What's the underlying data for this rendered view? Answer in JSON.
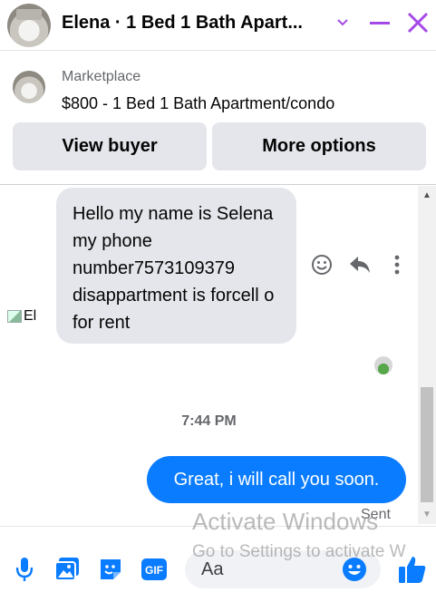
{
  "header": {
    "title": "Elena · 1 Bed 1 Bath Apart...",
    "accent_color": "#a548e8"
  },
  "listing": {
    "label": "Marketplace",
    "title": "$800 - 1 Bed 1 Bath Apartment/condo",
    "buttons": {
      "view_buyer": "View buyer",
      "more_options": "More options"
    }
  },
  "messages": {
    "incoming": {
      "text": "Hello my name is Selena my phone number7573109379 disappartment is forcell o for rent",
      "sender_alt": "El"
    },
    "timestamp": "7:44 PM",
    "outgoing": {
      "text": "Great, i will call you soon.",
      "status": "Sent",
      "color": "#0a7cff"
    }
  },
  "composer": {
    "placeholder": "Aa"
  },
  "watermark": {
    "line1": "Activate Windows",
    "line2": "Go to Settings to activate W"
  },
  "icons": [
    "chevron-down-icon",
    "minimize-icon",
    "close-icon",
    "emoji-icon",
    "reply-icon",
    "more-icon",
    "mic-icon",
    "image-icon",
    "sticker-icon",
    "gif-icon",
    "like-icon"
  ]
}
